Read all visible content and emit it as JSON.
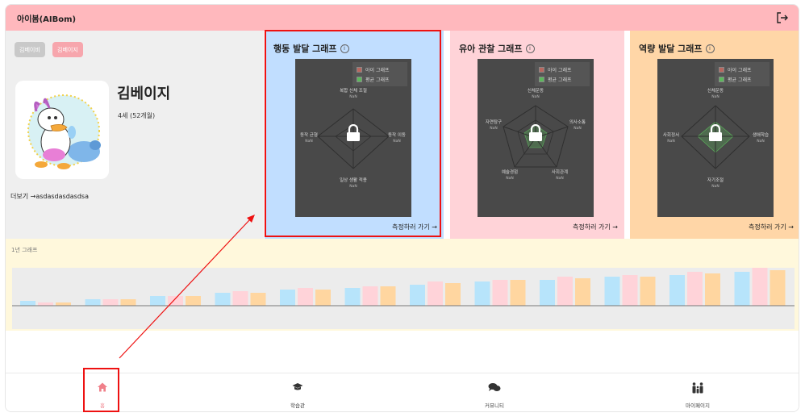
{
  "app": {
    "title": "아이봄(AIBom)"
  },
  "profile": {
    "chips": [
      "김베이비",
      "김베이지"
    ],
    "name": "김베이지",
    "age": "4세 (52개월)",
    "more": "더보기 →asdasdasdasdsa"
  },
  "cards": [
    {
      "title": "행동 발달 그래프",
      "bg": "#c1deff",
      "legend": [
        "아이 그래프",
        "평균 그래프"
      ],
      "axes": [
        "복합 신체 조절",
        "동작 이동",
        "일상 생활 적용",
        "동작 균형"
      ],
      "nan": "NaN",
      "link": "측정하러 가기 →",
      "highlighted": true
    },
    {
      "title": "유아 관찰 그래프",
      "bg": "#ffd3d8",
      "legend": [
        "아이 그래프",
        "평균 그래프"
      ],
      "axes": [
        "신체운동",
        "의사소통",
        "사회관계",
        "예술경험",
        "자연탐구"
      ],
      "nan": "NaN",
      "link": "측정하러 가기 →",
      "highlighted": false
    },
    {
      "title": "역량 발달 그래프",
      "bg": "#ffd6a7",
      "legend": [
        "아이 그래프",
        "평균 그래프"
      ],
      "axes": [
        "신체운동",
        "생애학습",
        "자기조절",
        "사회정서"
      ],
      "nan": "NaN",
      "link": "측정하러 가기 →",
      "highlighted": false
    }
  ],
  "yearly": {
    "title": "1년 그래프",
    "colors": [
      "#b7e4fb",
      "#ffd3d9",
      "#ffd6a0"
    ],
    "groups": [
      [
        3,
        2,
        2
      ],
      [
        4,
        4,
        4
      ],
      [
        6,
        6,
        6
      ],
      [
        8,
        9,
        8
      ],
      [
        10,
        11,
        10
      ],
      [
        11,
        12,
        12
      ],
      [
        13,
        15,
        14
      ],
      [
        15,
        16,
        16
      ],
      [
        16,
        18,
        17
      ],
      [
        18,
        19,
        18
      ],
      [
        19,
        21,
        20
      ],
      [
        21,
        24,
        22
      ]
    ]
  },
  "nav": [
    {
      "label": "홈",
      "icon": "home-icon",
      "active": true
    },
    {
      "label": "학습관",
      "icon": "graduation-cap-icon",
      "active": false
    },
    {
      "label": "커뮤니티",
      "icon": "chat-bubbles-icon",
      "active": false
    },
    {
      "label": "마이페이지",
      "icon": "family-icon",
      "active": false
    }
  ],
  "colors": {
    "header": "#ffb8bd",
    "accent": "#f0808a",
    "highlight": "#ee1111",
    "child_series": "#b9675f",
    "avg_series": "#5cb85c"
  }
}
